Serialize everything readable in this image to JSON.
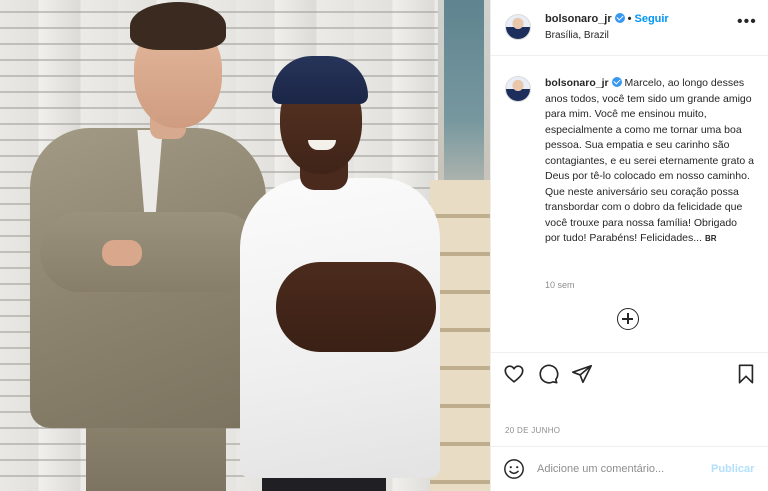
{
  "post": {
    "username": "bolsonaro_jr",
    "follow_label": "Seguir",
    "location": "Brasília, Brazil",
    "caption": "Marcelo, ao longo desses anos todos, você tem sido um grande amigo para mim. Você me ensinou muito, especialmente a como me tornar uma boa pessoa. Sua empatia e seu carinho são contagiantes, e eu serei eternamente grato a Deus por tê-lo colocado em nosso caminho. Que neste aniversário seu coração possa transbordar com o dobro da felicidade que você trouxe para nossa família! Obrigado por tudo! Parabéns! Felicidades...",
    "language_tag": "BR",
    "time_ago": "10 sem",
    "date": "20 DE JUNHO"
  },
  "comment": {
    "placeholder": "Adicione um comentário...",
    "publish_label": "Publicar"
  },
  "icons": {
    "more": "more-options-icon",
    "add": "add-circle-icon",
    "like": "heart-icon",
    "comment": "comment-icon",
    "share": "share-icon",
    "save": "bookmark-icon",
    "emoji": "emoji-icon"
  },
  "colors": {
    "link_blue": "#0095f6",
    "verified_blue": "#3897f0",
    "muted_text": "#8e8e8e",
    "publish_disabled": "#b2dffc"
  }
}
